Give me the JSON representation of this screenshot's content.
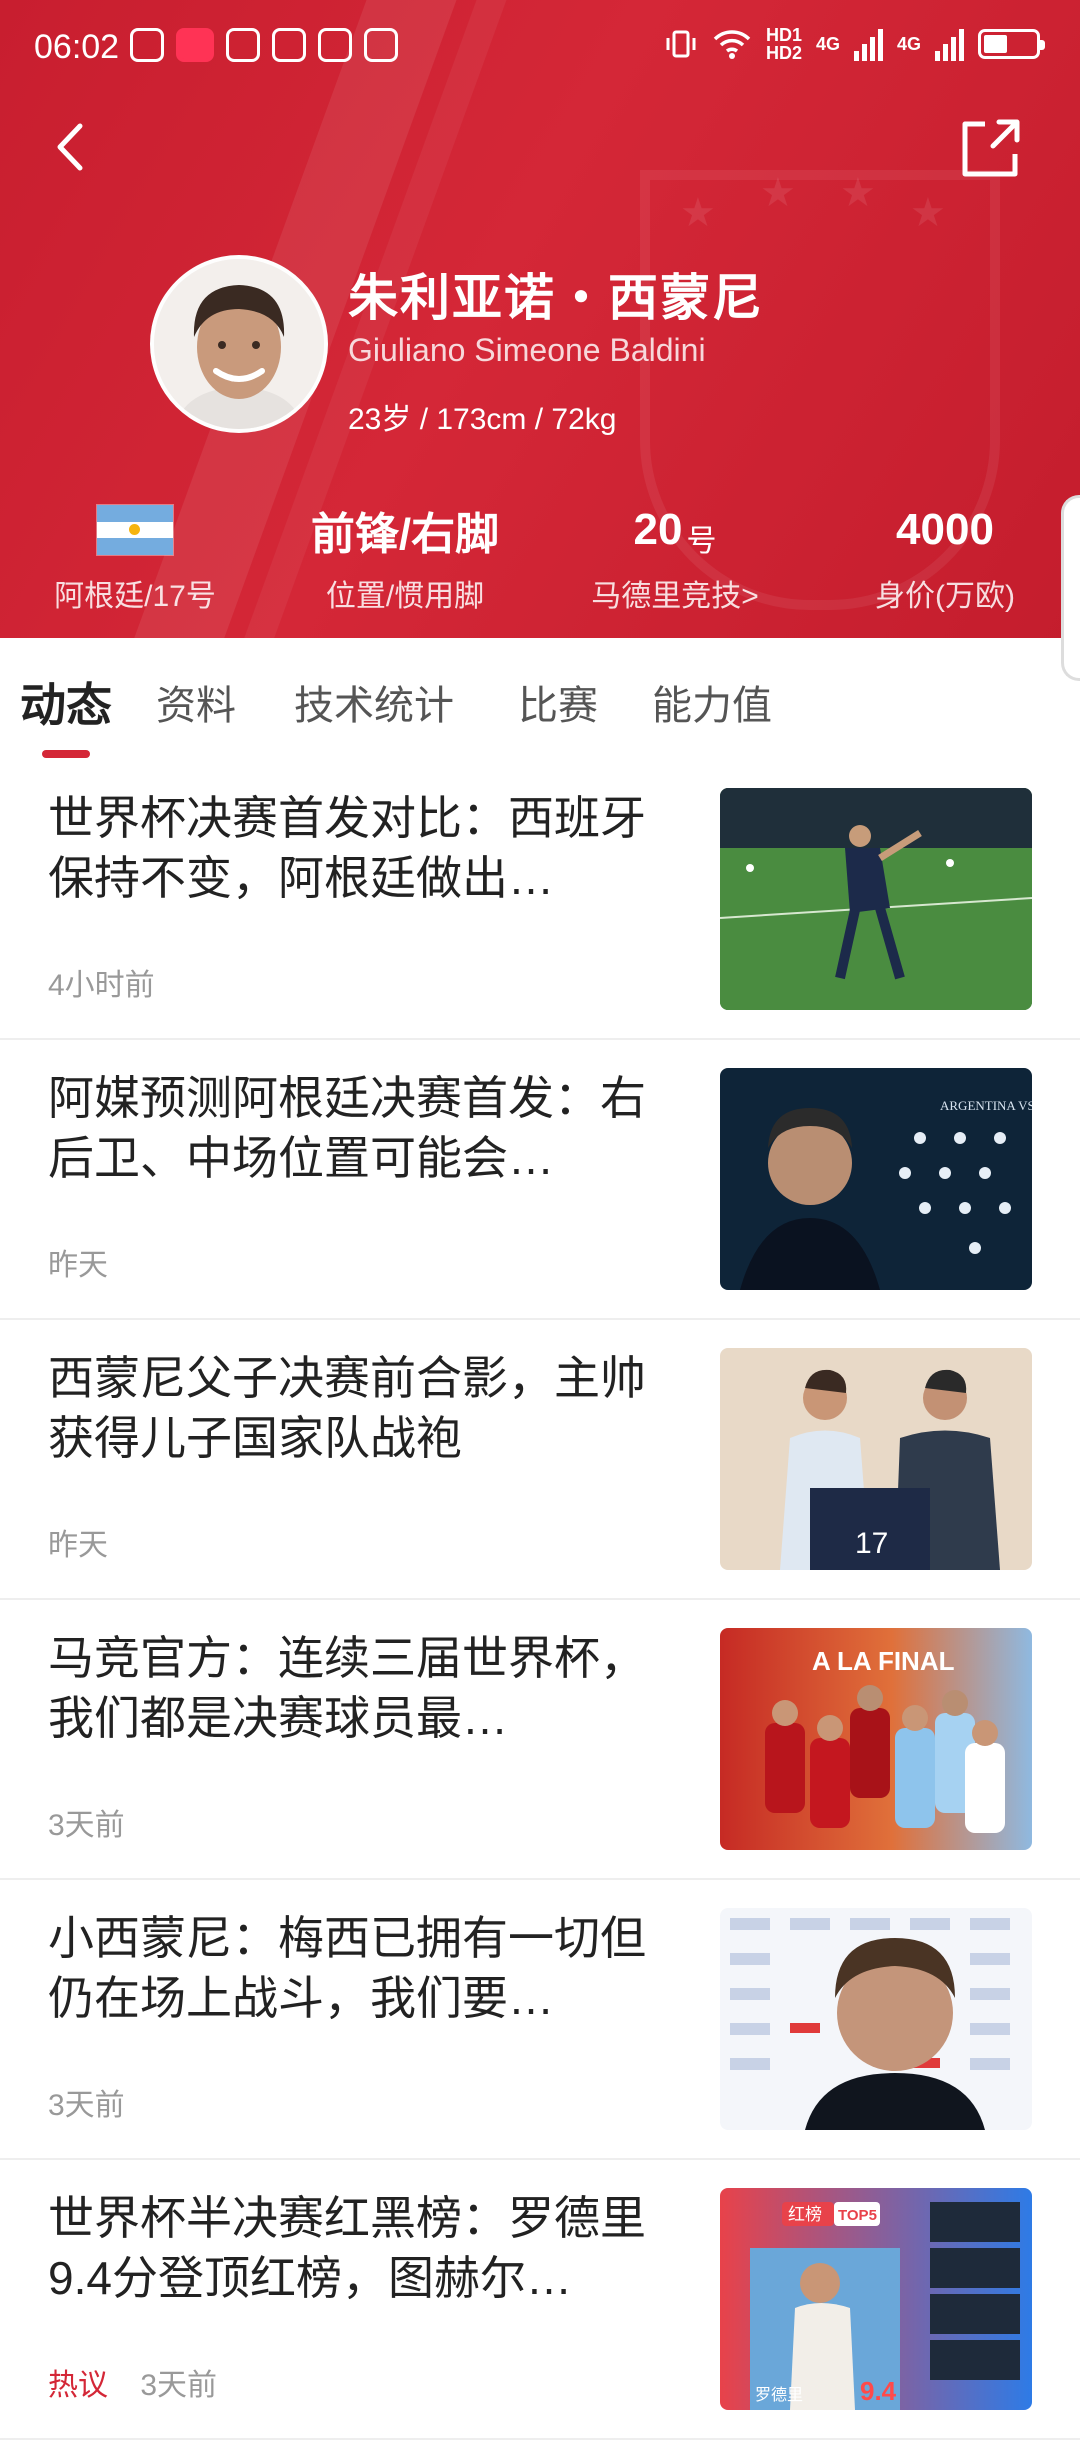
{
  "status_bar": {
    "time": "06:02",
    "network_1": "HD1",
    "network_2": "HD2",
    "lte_1": "4G",
    "lte_2": "4G"
  },
  "player": {
    "name_cn": "朱利亚诺・西蒙尼",
    "name_en": "Giuliano Simeone Baldini",
    "bio": "23岁 / 173cm / 72kg"
  },
  "stats": [
    {
      "label": "阿根廷/17号"
    },
    {
      "value": "前锋/右脚",
      "label": "位置/惯用脚"
    },
    {
      "value": "20",
      "suffix": "号",
      "label": "马德里竞技>"
    },
    {
      "value": "4000",
      "label": "身价(万欧)"
    }
  ],
  "tabs": [
    "动态",
    "资料",
    "技术统计",
    "比赛",
    "能力值"
  ],
  "news": [
    {
      "title": "世界杯决赛首发对比：西班牙保持不变，阿根廷做出…",
      "time": "4小时前"
    },
    {
      "title": "阿媒预测阿根廷决赛首发：右后卫、中场位置可能会…",
      "time": "昨天"
    },
    {
      "title": "西蒙尼父子决赛前合影，主帅获得儿子国家队战袍",
      "time": "昨天"
    },
    {
      "title": "马竞官方：连续三届世界杯，我们都是决赛球员最…",
      "time": "3天前"
    },
    {
      "title": "小西蒙尼：梅西已拥有一切但仍在场上战斗，我们要…",
      "time": "3天前"
    },
    {
      "title": "世界杯半决赛红黑榜：罗德里9.4分登顶红榜，图赫尔…",
      "time": "3天前",
      "tag": "热议"
    }
  ],
  "thumb_text": {
    "thumb2": "ARGENTINA VS",
    "thumb4": "A LA FINAL",
    "thumb6_badge": "红榜",
    "thumb6_top": "TOP5",
    "thumb6_name": "罗德里",
    "thumb6_score": "9.4"
  },
  "colors": {
    "brand_red": "#d42737",
    "text_main": "#222222",
    "text_meta": "#999999"
  }
}
